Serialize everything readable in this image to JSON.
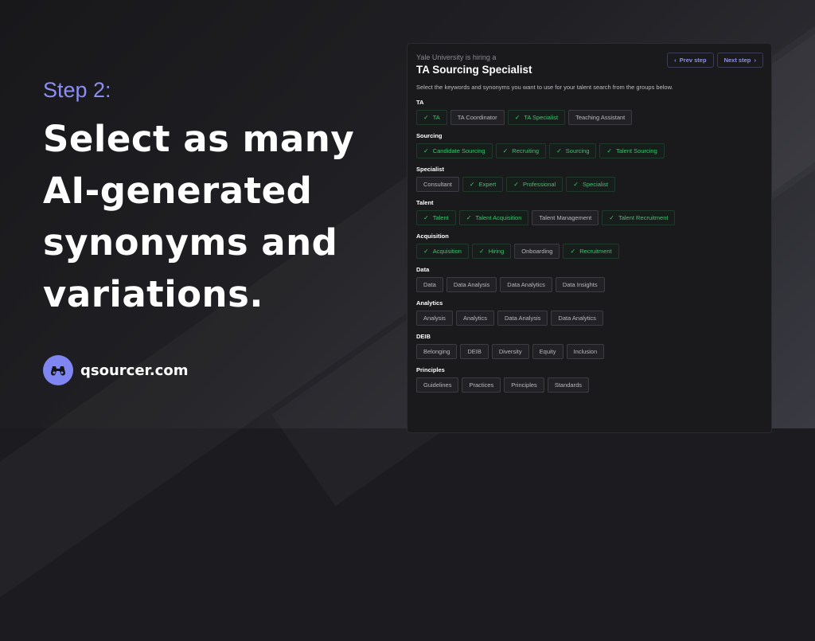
{
  "promo": {
    "step": "Step 2:",
    "headline": "Select as many AI-generated synonyms and variations.",
    "brand": "qsourcer.com"
  },
  "panel": {
    "hiring": "Yale University is hiring a",
    "title": "TA Sourcing Specialist",
    "description": "Select the keywords and synonyms you want to use for your talent search from the groups below.",
    "prev": "Prev step",
    "next": "Next step",
    "groups": [
      {
        "label": "TA",
        "chips": [
          {
            "t": "TA",
            "on": true
          },
          {
            "t": "TA Coordinator",
            "on": false
          },
          {
            "t": "TA Specialist",
            "on": true
          },
          {
            "t": "Teaching Assistant",
            "on": false
          }
        ]
      },
      {
        "label": "Sourcing",
        "chips": [
          {
            "t": "Candidate Sourcing",
            "on": true
          },
          {
            "t": "Recruiting",
            "on": true
          },
          {
            "t": "Sourcing",
            "on": true
          },
          {
            "t": "Talent Sourcing",
            "on": true
          }
        ]
      },
      {
        "label": "Specialist",
        "chips": [
          {
            "t": "Consultant",
            "on": false
          },
          {
            "t": "Expert",
            "on": true
          },
          {
            "t": "Professional",
            "on": true
          },
          {
            "t": "Specialist",
            "on": true
          }
        ]
      },
      {
        "label": "Talent",
        "chips": [
          {
            "t": "Talent",
            "on": true
          },
          {
            "t": "Talent Acquisition",
            "on": true
          },
          {
            "t": "Talent Management",
            "on": false
          },
          {
            "t": "Talent Recruitment",
            "on": true
          }
        ]
      },
      {
        "label": "Acquisition",
        "chips": [
          {
            "t": "Acquisition",
            "on": true
          },
          {
            "t": "Hiring",
            "on": true
          },
          {
            "t": "Onboarding",
            "on": false
          },
          {
            "t": "Recruitment",
            "on": true
          }
        ]
      },
      {
        "label": "Data",
        "chips": [
          {
            "t": "Data",
            "on": false
          },
          {
            "t": "Data Analysis",
            "on": false
          },
          {
            "t": "Data Analytics",
            "on": false
          },
          {
            "t": "Data Insights",
            "on": false
          }
        ]
      },
      {
        "label": "Analytics",
        "chips": [
          {
            "t": "Analysis",
            "on": false
          },
          {
            "t": "Analytics",
            "on": false
          },
          {
            "t": "Data Analysis",
            "on": false
          },
          {
            "t": "Data Analytics",
            "on": false
          }
        ]
      },
      {
        "label": "DEIB",
        "chips": [
          {
            "t": "Belonging",
            "on": false
          },
          {
            "t": "DEIB",
            "on": false
          },
          {
            "t": "Diversity",
            "on": false
          },
          {
            "t": "Equity",
            "on": false
          },
          {
            "t": "Inclusion",
            "on": false
          }
        ]
      },
      {
        "label": "Principles",
        "chips": [
          {
            "t": "Guidelines",
            "on": false
          },
          {
            "t": "Practices",
            "on": false
          },
          {
            "t": "Principles",
            "on": false
          },
          {
            "t": "Standards",
            "on": false
          }
        ]
      }
    ]
  }
}
